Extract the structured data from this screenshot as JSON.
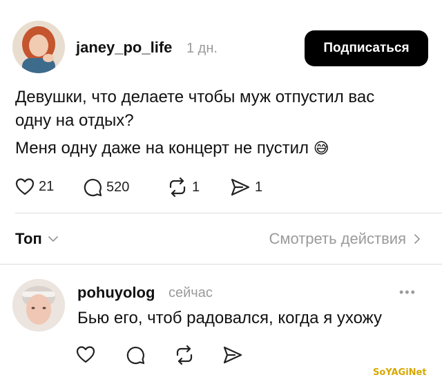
{
  "post": {
    "username": "janey_po_life",
    "time": "1 дн.",
    "follow_label": "Подписаться",
    "lines": [
      "Девушки, что делаете чтобы муж отпустил вас",
      "одну на отдых?",
      "Меня одну даже на концерт не пустил"
    ],
    "emoji": "😅",
    "likes": "21",
    "comments": "520",
    "reposts": "1",
    "shares": "1"
  },
  "thread": {
    "sort_label": "Топ",
    "view_actions_label": "Смотреть действия"
  },
  "reply": {
    "username": "pohuyolog",
    "time": "сейчас",
    "text": "Бью его, чтоб радовался, когда я ухожу",
    "more": "•••"
  },
  "watermark": "SoYAGiNet",
  "colors": {
    "accent": "#000000",
    "muted": "#9a9a9a",
    "divider": "#dcdcdc",
    "emoji": "#f5c542"
  },
  "icons": [
    "heart-icon",
    "comment-icon",
    "repost-icon",
    "share-icon",
    "chevron-down-icon",
    "chevron-right-icon",
    "more-icon"
  ]
}
